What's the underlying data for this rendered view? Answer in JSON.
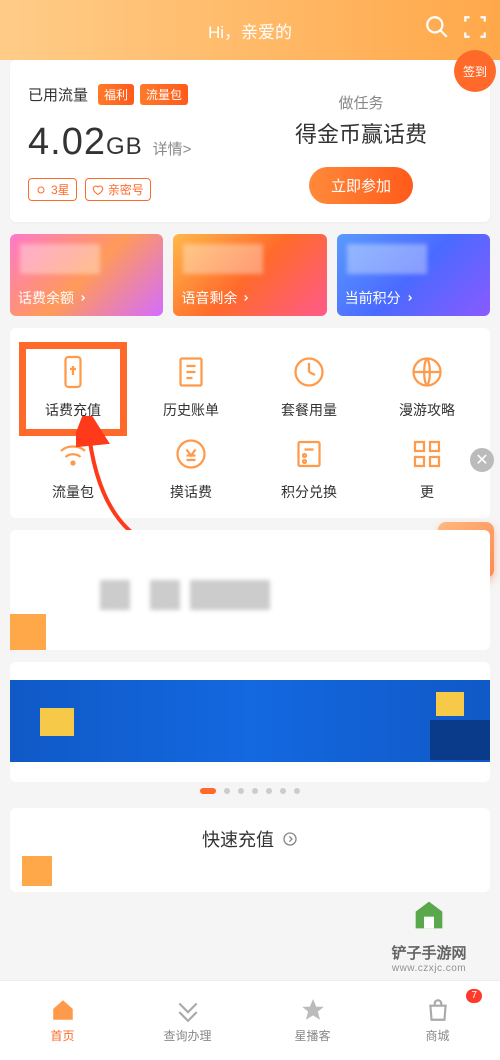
{
  "header": {
    "greeting": "Hi，亲爱的"
  },
  "main_card": {
    "checkin_label": "签到",
    "used_label": "已用流量",
    "tags": [
      "福利",
      "流量包"
    ],
    "usage_value": "4.02",
    "usage_unit": "GB",
    "detail_link": "详情>",
    "star_badge": "3星",
    "intimate_badge": "亲密号",
    "task_small": "做任务",
    "task_big": "得金币赢话费",
    "join_label": "立即参加"
  },
  "stats": [
    {
      "label": "话费余额"
    },
    {
      "label": "语音剩余"
    },
    {
      "label": "当前积分"
    }
  ],
  "grid": [
    {
      "label": "话费充值",
      "icon": "phone-recharge-icon",
      "highlight": true
    },
    {
      "label": "历史账单",
      "icon": "bill-history-icon"
    },
    {
      "label": "套餐用量",
      "icon": "usage-meter-icon"
    },
    {
      "label": "漫游攻略",
      "icon": "roaming-icon"
    },
    {
      "label": "流量包",
      "icon": "wifi-icon"
    },
    {
      "label": "摸话费",
      "icon": "coin-icon"
    },
    {
      "label": "积分兑换",
      "icon": "redeem-icon"
    },
    {
      "label": "更",
      "icon": "more-grid-icon"
    }
  ],
  "carousel_dots": {
    "count": 7,
    "active": 0
  },
  "quick_recharge": {
    "title": "快速充值"
  },
  "nav": [
    {
      "label": "首页",
      "active": true
    },
    {
      "label": "查询办理"
    },
    {
      "label": "星播客"
    },
    {
      "label": "商城",
      "badge": "7"
    }
  ],
  "watermark": {
    "cn": "铲子手游网",
    "url": "www.czxjc.com"
  }
}
